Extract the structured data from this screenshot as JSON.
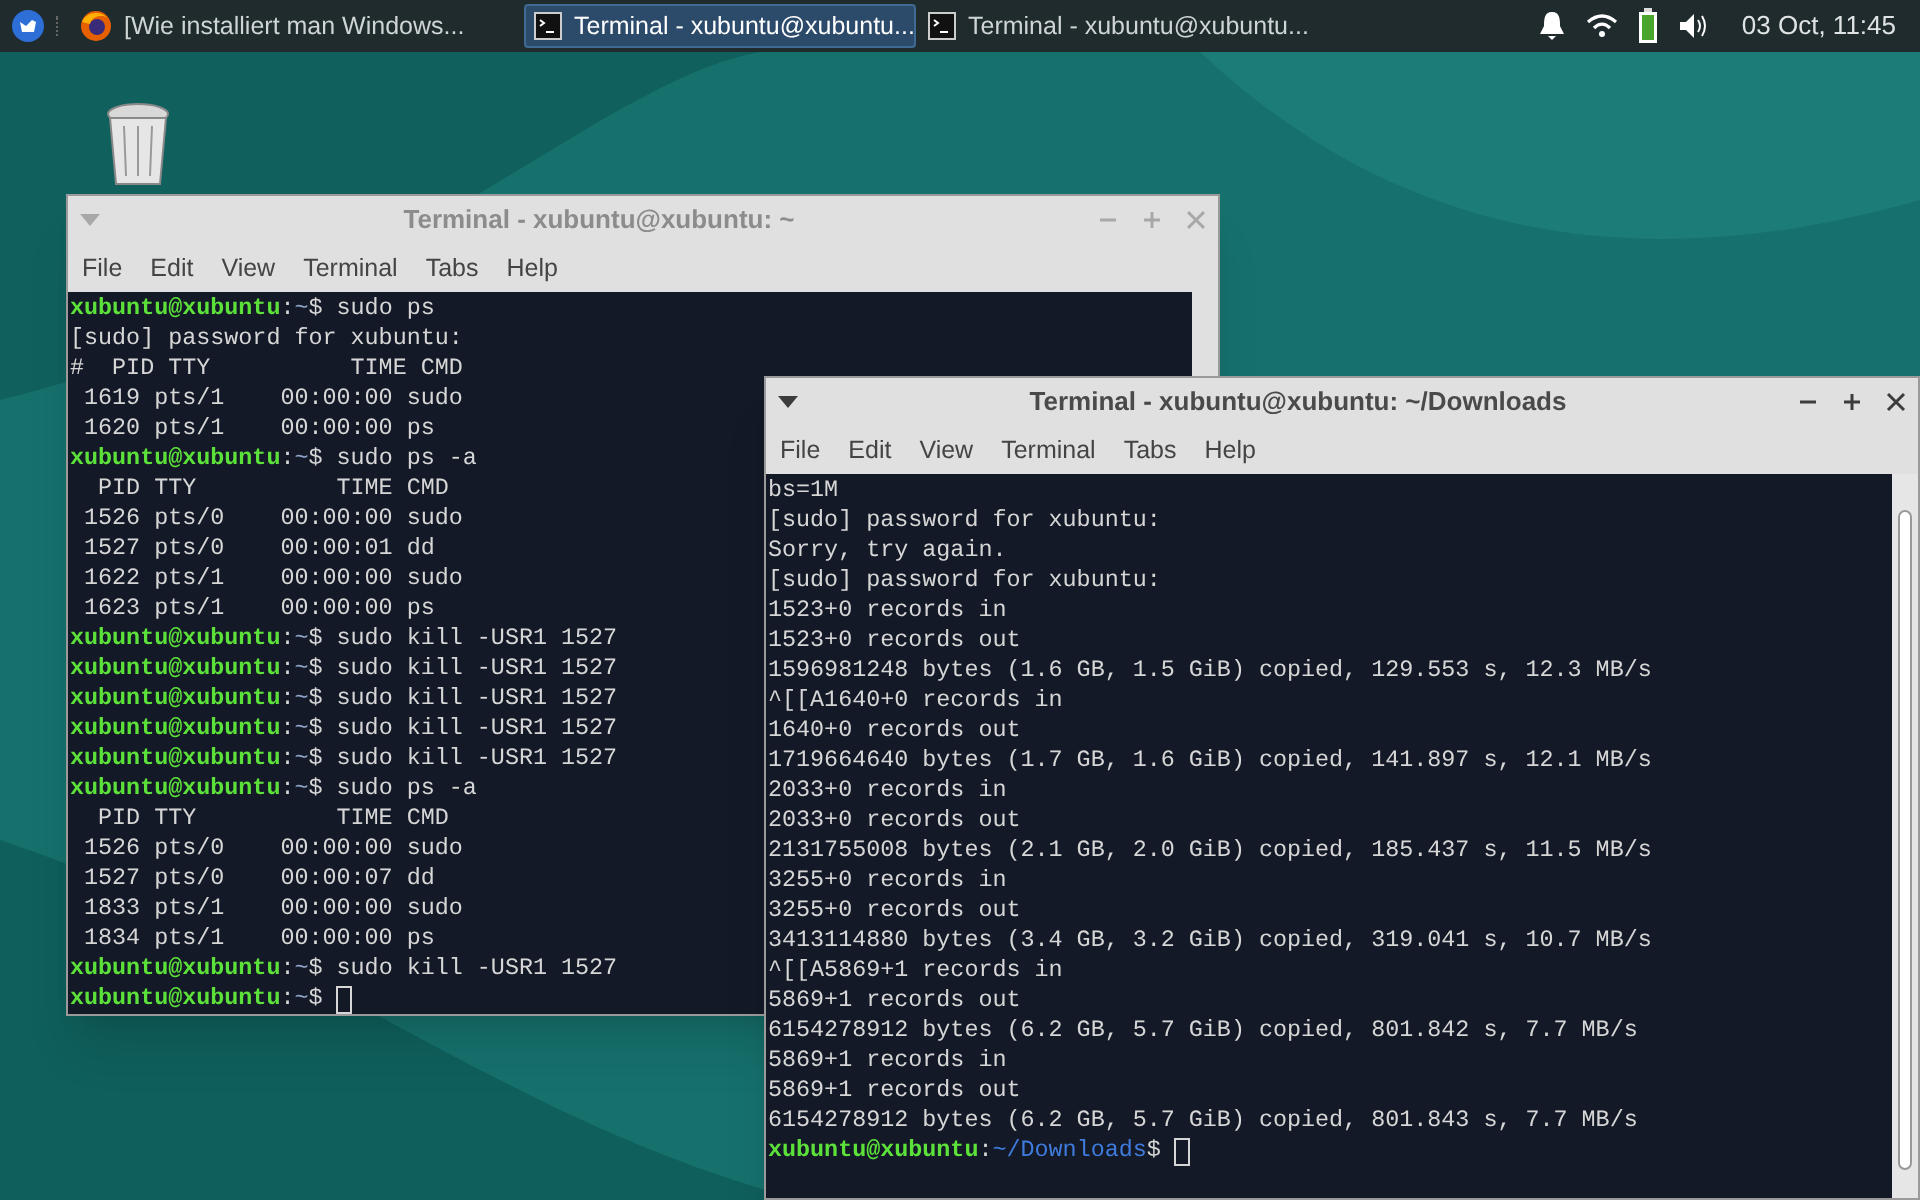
{
  "taskbar": {
    "apps": [
      {
        "kind": "firefox",
        "label": "[Wie installiert man Windows...",
        "selected": false
      },
      {
        "kind": "terminal",
        "label": "Terminal - xubuntu@xubuntu...",
        "selected": true
      },
      {
        "kind": "terminal",
        "label": "Terminal - xubuntu@xubuntu...",
        "selected": false
      }
    ],
    "clock": "03 Oct, 11:45"
  },
  "windows": [
    {
      "title": "Terminal - xubuntu@xubuntu: ~",
      "active": false,
      "menu": [
        "File",
        "Edit",
        "View",
        "Terminal",
        "Tabs",
        "Help"
      ],
      "lines": [
        {
          "kind": "prompt",
          "user": "xubuntu@xubuntu",
          "separator": ":",
          "path": "~",
          "symbol": "$",
          "command": "sudo ps"
        },
        {
          "kind": "output",
          "text": "[sudo] password for xubuntu:"
        },
        {
          "kind": "output",
          "text": "#  PID TTY          TIME CMD"
        },
        {
          "kind": "output",
          "text": " 1619 pts/1    00:00:00 sudo"
        },
        {
          "kind": "output",
          "text": " 1620 pts/1    00:00:00 ps"
        },
        {
          "kind": "prompt",
          "user": "xubuntu@xubuntu",
          "separator": ":",
          "path": "~",
          "symbol": "$",
          "command": "sudo ps -a"
        },
        {
          "kind": "output",
          "text": "  PID TTY          TIME CMD"
        },
        {
          "kind": "output",
          "text": " 1526 pts/0    00:00:00 sudo"
        },
        {
          "kind": "output",
          "text": " 1527 pts/0    00:00:01 dd"
        },
        {
          "kind": "output",
          "text": " 1622 pts/1    00:00:00 sudo"
        },
        {
          "kind": "output",
          "text": " 1623 pts/1    00:00:00 ps"
        },
        {
          "kind": "prompt",
          "user": "xubuntu@xubuntu",
          "separator": ":",
          "path": "~",
          "symbol": "$",
          "command": "sudo kill -USR1 1527"
        },
        {
          "kind": "prompt",
          "user": "xubuntu@xubuntu",
          "separator": ":",
          "path": "~",
          "symbol": "$",
          "command": "sudo kill -USR1 1527"
        },
        {
          "kind": "prompt",
          "user": "xubuntu@xubuntu",
          "separator": ":",
          "path": "~",
          "symbol": "$",
          "command": "sudo kill -USR1 1527"
        },
        {
          "kind": "prompt",
          "user": "xubuntu@xubuntu",
          "separator": ":",
          "path": "~",
          "symbol": "$",
          "command": "sudo kill -USR1 1527"
        },
        {
          "kind": "prompt",
          "user": "xubuntu@xubuntu",
          "separator": ":",
          "path": "~",
          "symbol": "$",
          "command": "sudo kill -USR1 1527"
        },
        {
          "kind": "prompt",
          "user": "xubuntu@xubuntu",
          "separator": ":",
          "path": "~",
          "symbol": "$",
          "command": "sudo ps -a"
        },
        {
          "kind": "output",
          "text": "  PID TTY          TIME CMD"
        },
        {
          "kind": "output",
          "text": " 1526 pts/0    00:00:00 sudo"
        },
        {
          "kind": "output",
          "text": " 1527 pts/0    00:00:07 dd"
        },
        {
          "kind": "output",
          "text": " 1833 pts/1    00:00:00 sudo"
        },
        {
          "kind": "output",
          "text": " 1834 pts/1    00:00:00 ps"
        },
        {
          "kind": "prompt",
          "user": "xubuntu@xubuntu",
          "separator": ":",
          "path": "~",
          "symbol": "$",
          "command": "sudo kill -USR1 1527"
        },
        {
          "kind": "prompt",
          "user": "xubuntu@xubuntu",
          "separator": ":",
          "path": "~",
          "symbol": "$"
        }
      ],
      "cursor": true
    },
    {
      "title": "Terminal - xubuntu@xubuntu: ~/Downloads",
      "active": true,
      "menu": [
        "File",
        "Edit",
        "View",
        "Terminal",
        "Tabs",
        "Help"
      ],
      "lines": [
        {
          "kind": "output",
          "text": "bs=1M"
        },
        {
          "kind": "output",
          "text": "[sudo] password for xubuntu:"
        },
        {
          "kind": "output",
          "text": "Sorry, try again."
        },
        {
          "kind": "output",
          "text": "[sudo] password for xubuntu:"
        },
        {
          "kind": "output",
          "text": "1523+0 records in"
        },
        {
          "kind": "output",
          "text": "1523+0 records out"
        },
        {
          "kind": "output",
          "text": "1596981248 bytes (1.6 GB, 1.5 GiB) copied, 129.553 s, 12.3 MB/s"
        },
        {
          "kind": "output",
          "text": "^[[A1640+0 records in"
        },
        {
          "kind": "output",
          "text": "1640+0 records out"
        },
        {
          "kind": "output",
          "text": "1719664640 bytes (1.7 GB, 1.6 GiB) copied, 141.897 s, 12.1 MB/s"
        },
        {
          "kind": "output",
          "text": "2033+0 records in"
        },
        {
          "kind": "output",
          "text": "2033+0 records out"
        },
        {
          "kind": "output",
          "text": "2131755008 bytes (2.1 GB, 2.0 GiB) copied, 185.437 s, 11.5 MB/s"
        },
        {
          "kind": "output",
          "text": "3255+0 records in"
        },
        {
          "kind": "output",
          "text": "3255+0 records out"
        },
        {
          "kind": "output",
          "text": "3413114880 bytes (3.4 GB, 3.2 GiB) copied, 319.041 s, 10.7 MB/s"
        },
        {
          "kind": "output",
          "text": "^[[A5869+1 records in"
        },
        {
          "kind": "output",
          "text": "5869+1 records out"
        },
        {
          "kind": "output",
          "text": "6154278912 bytes (6.2 GB, 5.7 GiB) copied, 801.842 s, 7.7 MB/s"
        },
        {
          "kind": "output",
          "text": "5869+1 records in"
        },
        {
          "kind": "output",
          "text": "5869+1 records out"
        },
        {
          "kind": "output",
          "text": "6154278912 bytes (6.2 GB, 5.7 GiB) copied, 801.843 s, 7.7 MB/s"
        },
        {
          "kind": "prompt",
          "user": "xubuntu@xubuntu",
          "separator": ":",
          "path": "~/Downloads",
          "symbol": "$"
        }
      ],
      "cursor": true,
      "scrollbar": true
    }
  ]
}
